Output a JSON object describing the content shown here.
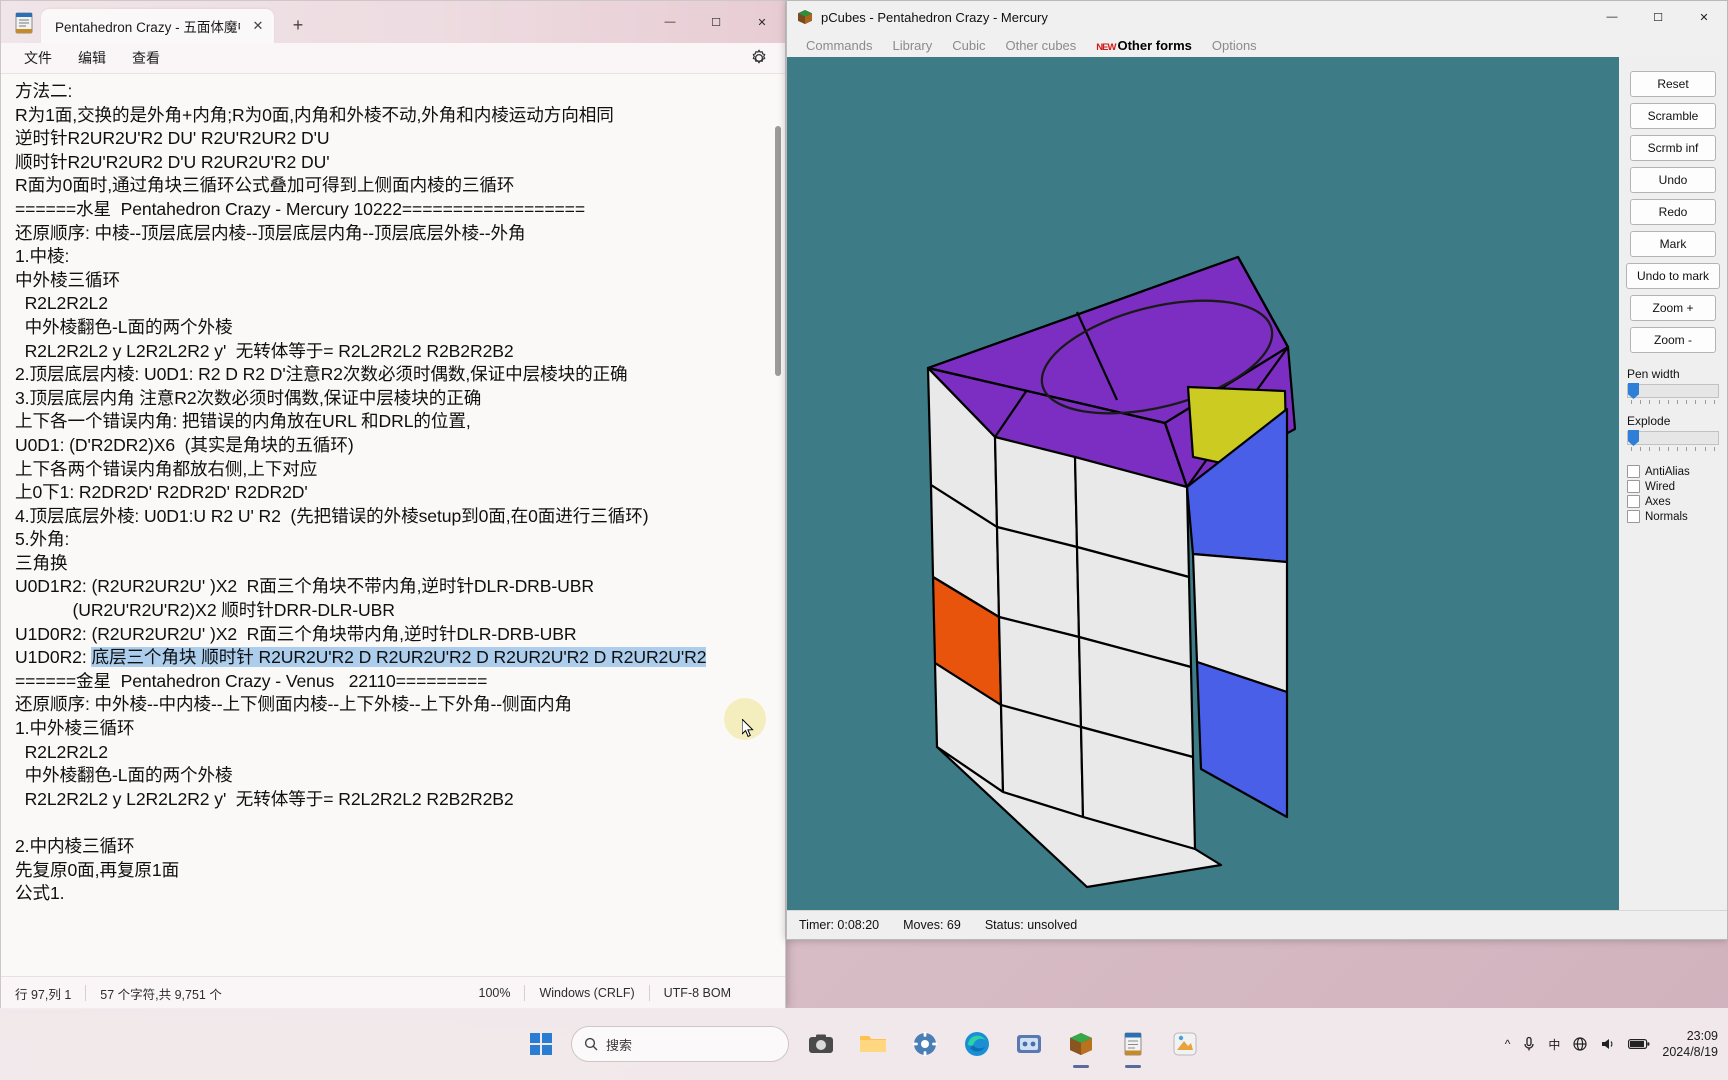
{
  "notepad": {
    "app_icon": "notepad-icon",
    "tab": {
      "label": "Pentahedron Crazy - 五面体魔中魔",
      "close_label": "✕"
    },
    "new_tab_label": "+",
    "window_controls": {
      "minimize": "—",
      "maximize": "☐",
      "close": "✕"
    },
    "menu": [
      "文件",
      "编辑",
      "查看"
    ],
    "settings_icon": "gear-icon",
    "document_lines": [
      "方法二:",
      "R为1面,交换的是外角+内角;R为0面,内角和外棱不动,外角和内棱运动方向相同",
      "逆时针R2UR2U'R2 DU' R2U'R2UR2 D'U",
      "顺时针R2U'R2UR2 D'U R2UR2U'R2 DU'",
      "R面为0面时,通过角块三循环公式叠加可得到上侧面内棱的三循环",
      "======水星  Pentahedron Crazy - Mercury 10222==================",
      "还原顺序: 中棱--顶层底层内棱--顶层底层内角--顶层底层外棱--外角",
      "1.中棱:",
      "中外棱三循环",
      "  R2L2R2L2",
      "  中外棱翻色-L面的两个外棱",
      "  R2L2R2L2 y L2R2L2R2 y'  无转体等于= R2L2R2L2 R2B2R2B2",
      "2.顶层底层内棱: U0D1: R2 D R2 D'注意R2次数必须时偶数,保证中层棱块的正确",
      "3.顶层底层内角 注意R2次数必须时偶数,保证中层棱块的正确",
      "上下各一个错误内角: 把错误的内角放在URL 和DRL的位置,",
      "U0D1: (D'R2DR2)X6  (其实是角块的五循环)",
      "上下各两个错误内角都放右侧,上下对应",
      "上0下1: R2DR2D' R2DR2D' R2DR2D'",
      "4.顶层底层外棱: U0D1:U R2 U' R2  (先把错误的外棱setup到0面,在0面进行三循环)",
      "5.外角:",
      "三角换",
      "U0D1R2: (R2UR2UR2U' )X2  R面三个角块不带内角,逆时针DLR-DRB-UBR",
      "            (UR2U'R2U'R2)X2 顺时针DRR-DLR-UBR",
      "U1D0R2: (R2UR2UR2U' )X2  R面三个角块带内角,逆时针DLR-DRB-UBR"
    ],
    "selected_line": {
      "prefix": "U1D0R2: ",
      "highlighted": "底层三个角块 顺时针 R2UR2U'R2 D R2UR2U'R2 D R2UR2U'R2 D R2UR2U'R2"
    },
    "document_lines_after": [
      "======金星  Pentahedron Crazy - Venus   22110=========",
      "还原顺序: 中外棱--中内棱--上下侧面内棱--上下外棱--上下外角--侧面内角",
      "1.中外棱三循环",
      "  R2L2R2L2",
      "  中外棱翻色-L面的两个外棱",
      "  R2L2R2L2 y L2R2L2R2 y'  无转体等于= R2L2R2L2 R2B2R2B2",
      "",
      "2.中内棱三循环",
      "先复原0面,再复原1面",
      "公式1."
    ],
    "status": {
      "cursor": "行 97,列 1",
      "chars": "57 个字符,共 9,751 个",
      "zoom": "100%",
      "line_ending": "Windows (CRLF)",
      "encoding": "UTF-8 BOM"
    }
  },
  "pcubes": {
    "icon": "pcubes-icon",
    "title": "pCubes - Pentahedron Crazy - Mercury",
    "window_controls": {
      "minimize": "—",
      "maximize": "☐",
      "close": "✕"
    },
    "menu": [
      {
        "label": "Commands",
        "active": false,
        "badge": ""
      },
      {
        "label": "Library",
        "active": false,
        "badge": ""
      },
      {
        "label": "Cubic",
        "active": false,
        "badge": ""
      },
      {
        "label": "Other cubes",
        "active": false,
        "badge": ""
      },
      {
        "label": "Other forms",
        "active": true,
        "badge": "NEW"
      },
      {
        "label": "Options",
        "active": false,
        "badge": ""
      }
    ],
    "sidebar": {
      "buttons": [
        "Reset",
        "Scramble",
        "Scrmb inf",
        "Undo",
        "Redo",
        "Mark",
        "Undo to mark",
        "Zoom +",
        "Zoom -"
      ],
      "sliders": [
        {
          "label": "Pen width",
          "value": 0
        },
        {
          "label": "Explode",
          "value": 0
        }
      ],
      "checkboxes": [
        {
          "label": "AntiAlias",
          "checked": false
        },
        {
          "label": "Wired",
          "checked": false
        },
        {
          "label": "Axes",
          "checked": false
        },
        {
          "label": "Normals",
          "checked": false
        }
      ]
    },
    "status": {
      "timer": "Timer: 0:08:20",
      "moves": "Moves: 69",
      "state": "Status: unsolved"
    },
    "canvas": {
      "background_color": "#3d7b86",
      "face_colors": {
        "top": "#7d2ec2",
        "front": "#e9e9e9",
        "right": "#4a5fe8",
        "accent_yellow": "#cbcb22",
        "accent_orange": "#e8540c"
      }
    }
  },
  "taskbar": {
    "start_label": "start-icon",
    "search_placeholder": "搜索",
    "search_icon": "search-icon",
    "apps": [
      {
        "name": "file-explorer-icon",
        "active": false
      },
      {
        "name": "settings-icon",
        "active": false
      },
      {
        "name": "edge-icon",
        "active": false
      },
      {
        "name": "media-icon",
        "active": false
      },
      {
        "name": "pcubes-icon",
        "active": true
      },
      {
        "name": "notepad-icon",
        "active": true
      },
      {
        "name": "paint-icon",
        "active": false
      }
    ],
    "tray": {
      "chevron": "^",
      "mic_icon": "mic-icon",
      "ime": "中",
      "network_icon": "network-icon",
      "volume_icon": "volume-icon",
      "battery_icon": "battery-icon"
    },
    "clock": {
      "time": "23:09",
      "date": "2024/8/19"
    }
  }
}
